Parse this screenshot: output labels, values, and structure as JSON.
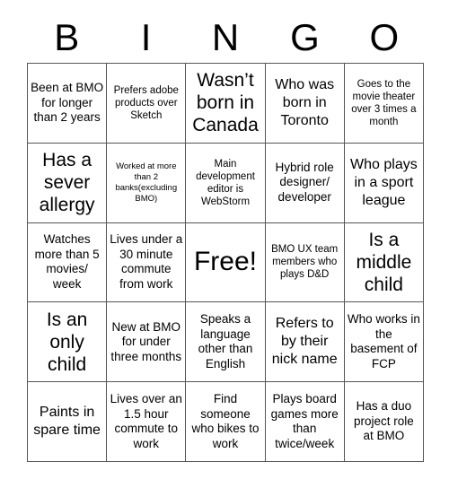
{
  "header": {
    "letters": [
      "B",
      "I",
      "N",
      "G",
      "O"
    ]
  },
  "grid": {
    "rows": [
      [
        {
          "text": "Been at BMO for longer than 2 years",
          "size": "fs-m"
        },
        {
          "text": "Prefers adobe products over Sketch",
          "size": "fs-s"
        },
        {
          "text": "Wasn’t born in Canada",
          "size": "fs-xl"
        },
        {
          "text": "Who was born in Toronto",
          "size": "fs-l"
        },
        {
          "text": "Goes to the movie theater over 3 times a month",
          "size": "fs-s"
        }
      ],
      [
        {
          "text": "Has a sever allergy",
          "size": "fs-xl"
        },
        {
          "text": "Worked at more than 2 banks(excluding BMO)",
          "size": "fs-xs"
        },
        {
          "text": "Main development editor is WebStorm",
          "size": "fs-s"
        },
        {
          "text": "Hybrid role designer/ developer",
          "size": "fs-m"
        },
        {
          "text": "Who plays in a sport league",
          "size": "fs-l"
        }
      ],
      [
        {
          "text": "Watches more than 5 movies/ week",
          "size": "fs-m"
        },
        {
          "text": "Lives under a 30 minute commute from work",
          "size": "fs-m"
        },
        {
          "text": "Free!",
          "size": "fs-xxl"
        },
        {
          "text": "BMO UX team members who plays D&D",
          "size": "fs-s"
        },
        {
          "text": "Is a middle child",
          "size": "fs-xl"
        }
      ],
      [
        {
          "text": "Is an only child",
          "size": "fs-xl"
        },
        {
          "text": "New at BMO for under three months",
          "size": "fs-m"
        },
        {
          "text": "Speaks a language other than English",
          "size": "fs-m"
        },
        {
          "text": "Refers to by their nick name",
          "size": "fs-l"
        },
        {
          "text": "Who works in the basement of FCP",
          "size": "fs-m"
        }
      ],
      [
        {
          "text": "Paints in spare time",
          "size": "fs-l"
        },
        {
          "text": "Lives over an 1.5 hour commute to work",
          "size": "fs-m"
        },
        {
          "text": "Find someone who bikes to work",
          "size": "fs-m"
        },
        {
          "text": "Plays board games more than twice/week",
          "size": "fs-m"
        },
        {
          "text": "Has a duo project role at BMO",
          "size": "fs-m"
        }
      ]
    ]
  }
}
